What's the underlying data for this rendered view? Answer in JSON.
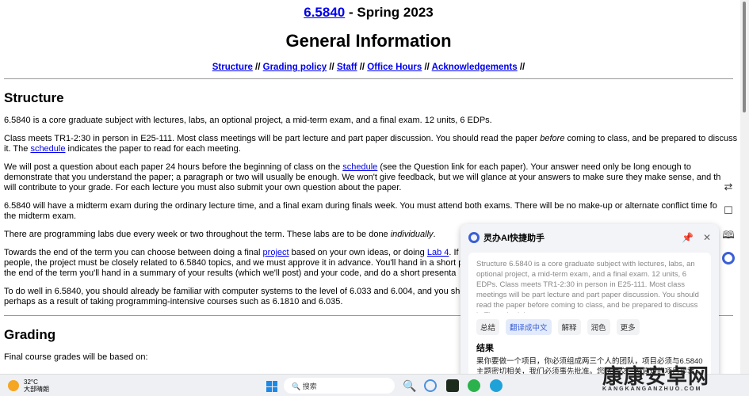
{
  "header": {
    "course_link": "6.5840",
    "title_suffix": " - Spring 2023",
    "subtitle": "General Information"
  },
  "nav": {
    "items": [
      "Structure",
      "Grading policy",
      "Staff",
      "Office Hours",
      "Acknowledgements"
    ],
    "separator": " // "
  },
  "structure": {
    "heading": "Structure",
    "p1": "6.5840 is a core graduate subject with lectures, labs, an optional project, a mid-term exam, and a final exam. 12 units, 6 EDPs.",
    "p2a": "Class meets TR1-2:30 in person in E25-111. Most class meetings will be part lecture and part paper discussion. You should read the paper ",
    "p2em": "before",
    "p2b": " coming to class, and be prepared to discuss",
    "p2c": "it. The ",
    "p2link": "schedule",
    "p2d": " indicates the paper to read for each meeting.",
    "p3a": "We will post a question about each paper 24 hours before the beginning of class on the ",
    "p3link": "schedule",
    "p3b": " (see the Question link for each paper). Your answer need only be long enough to",
    "p3c": "demonstrate that you understand the paper; a paragraph or two will usually be enough. We won't give feedback, but we will glance at your answers to make sure they make sense, and th",
    "p3d": "will contribute to your grade. For each lecture you must also submit your own question about the paper.",
    "p4a": "6.5840 will have a midterm exam during the ordinary lecture time, and a final exam during finals week. You must attend both exams. There will be no make-up or alternate conflict time fo",
    "p4b": "the midterm exam.",
    "p5a": "There are programming labs due every week or two throughout the term. These labs are to be done ",
    "p5em": "individually",
    "p5b": ".",
    "p6a": "Towards the end of the term you can choose between doing a final ",
    "p6link1": "project",
    "p6b": " based on your own ideas, or doing ",
    "p6link2": "Lab 4",
    "p6c": ". If",
    "p6d": "people, the project must be closely related to 6.5840 topics, and we must approve it in advance. You'll hand in a short p",
    "p6e": "the end of the term you'll hand in a summary of your results (which we'll post) and your code, and do a short presenta",
    "p7a": "To do well in 6.5840, you should already be familiar with computer systems to the level of 6.033 and 6.004, and you sho",
    "p7b": "perhaps as a result of taking programming-intensive courses such as 6.1810 and 6.035."
  },
  "grading": {
    "heading": "Grading",
    "p1": "Final course grades will be based on:"
  },
  "assistant": {
    "title": "灵办AI快捷助手",
    "source": "Structure 6.5840 is a core graduate subject with lectures, labs, an optional project, a mid-term exam, and a final exam. 12 units, 6 EDPs. Class meets TR1-2:30 in person in E25-111. Most class meetings will be part lecture and part paper discussion. You should read the paper before coming to class, and be prepared to discuss it. The schedule",
    "buttons": [
      "总结",
      "翻译成中文",
      "解释",
      "润色",
      "更多"
    ],
    "result_label": "结果",
    "result": "果你要做一个项目，你必须组成两三个人的团队，项目必须与6.5840主题密切相关，我们必须事先批准。您将提交一份简短的项目提案，在期末我们"
  },
  "taskbar": {
    "temp": "32°C",
    "weather": "大部晴朗",
    "search_placeholder": "搜索"
  },
  "watermark": {
    "text": "康康安卓网",
    "sub": "KANGKANGANZHUO.COM"
  }
}
